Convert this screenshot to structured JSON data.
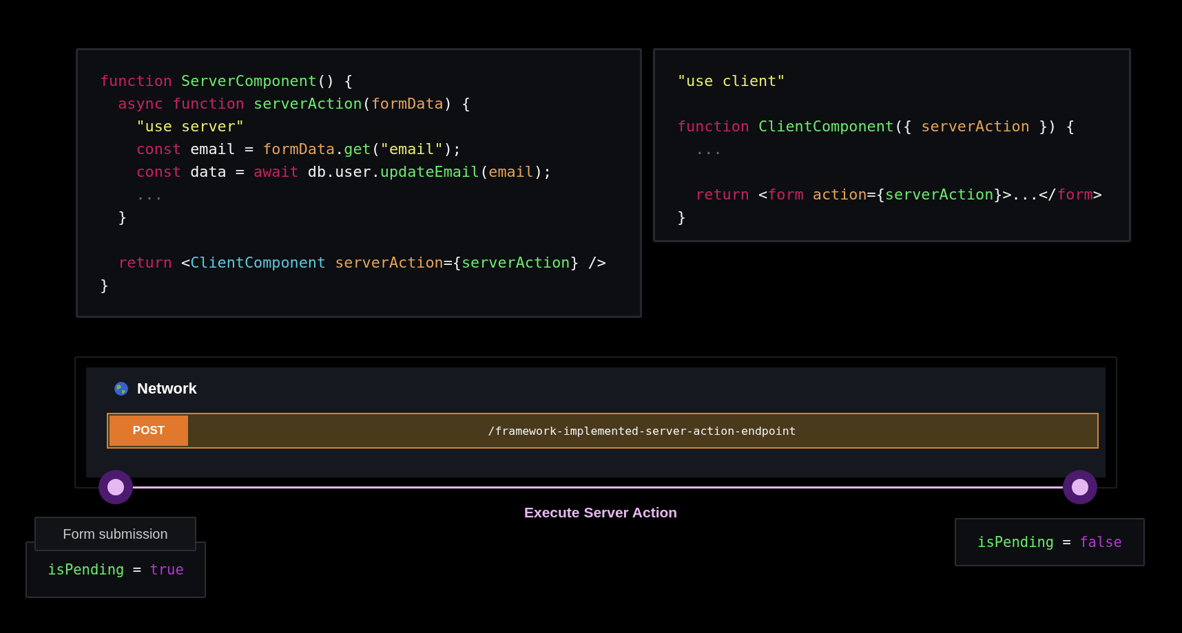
{
  "server_code": {
    "lines": [
      {
        "tokens": [
          {
            "kind": "keyword",
            "text": "function "
          },
          {
            "kind": "fn",
            "text": "ServerComponent"
          },
          {
            "kind": "plain",
            "text": "() {"
          }
        ]
      },
      {
        "tokens": [
          {
            "kind": "keyword",
            "text": "  async function "
          },
          {
            "kind": "fn",
            "text": "serverAction"
          },
          {
            "kind": "plain",
            "text": "("
          },
          {
            "kind": "param",
            "text": "formData"
          },
          {
            "kind": "plain",
            "text": ") {"
          }
        ]
      },
      {
        "tokens": [
          {
            "kind": "string",
            "text": "    \"use server\""
          }
        ]
      },
      {
        "tokens": [
          {
            "kind": "keyword",
            "text": "    const"
          },
          {
            "kind": "plain",
            "text": " email = "
          },
          {
            "kind": "param",
            "text": "formData"
          },
          {
            "kind": "plain",
            "text": "."
          },
          {
            "kind": "fn",
            "text": "get"
          },
          {
            "kind": "plain",
            "text": "("
          },
          {
            "kind": "string",
            "text": "\"email\""
          },
          {
            "kind": "plain",
            "text": ");"
          }
        ]
      },
      {
        "tokens": [
          {
            "kind": "keyword",
            "text": "    const"
          },
          {
            "kind": "plain",
            "text": " data = "
          },
          {
            "kind": "keyword",
            "text": "await"
          },
          {
            "kind": "plain",
            "text": " db.user."
          },
          {
            "kind": "fn",
            "text": "updateEmail"
          },
          {
            "kind": "plain",
            "text": "("
          },
          {
            "kind": "param",
            "text": "email"
          },
          {
            "kind": "plain",
            "text": ");"
          }
        ]
      },
      {
        "tokens": [
          {
            "kind": "comment",
            "text": "    ..."
          }
        ]
      },
      {
        "tokens": [
          {
            "kind": "plain",
            "text": "  }"
          }
        ]
      },
      {
        "blank_before": true,
        "tokens": [
          {
            "kind": "keyword",
            "text": "  return"
          },
          {
            "kind": "plain",
            "text": " <"
          },
          {
            "kind": "component",
            "text": "ClientComponent "
          },
          {
            "kind": "param",
            "text": "serverAction"
          },
          {
            "kind": "plain",
            "text": "={"
          },
          {
            "kind": "fn",
            "text": "serverAction"
          },
          {
            "kind": "plain",
            "text": "} />"
          }
        ]
      },
      {
        "tokens": [
          {
            "kind": "plain",
            "text": "}"
          }
        ]
      }
    ]
  },
  "client_code": {
    "lines": [
      {
        "tokens": [
          {
            "kind": "string",
            "text": "\"use client\""
          }
        ]
      },
      {
        "blank_before": true,
        "tokens": [
          {
            "kind": "keyword",
            "text": "function "
          },
          {
            "kind": "fn",
            "text": "ClientComponent"
          },
          {
            "kind": "plain",
            "text": "({ "
          },
          {
            "kind": "param",
            "text": "serverAction"
          },
          {
            "kind": "plain",
            "text": " }) {"
          }
        ]
      },
      {
        "tokens": [
          {
            "kind": "comment",
            "text": "  ..."
          }
        ]
      },
      {
        "blank_before": true,
        "tokens": [
          {
            "kind": "keyword",
            "text": "  return"
          },
          {
            "kind": "plain",
            "text": " <"
          },
          {
            "kind": "keyword",
            "text": "form "
          },
          {
            "kind": "param",
            "text": "action"
          },
          {
            "kind": "plain",
            "text": "={"
          },
          {
            "kind": "fn",
            "text": "serverAction"
          },
          {
            "kind": "plain",
            "text": "}>...</"
          },
          {
            "kind": "keyword",
            "text": "form"
          },
          {
            "kind": "plain",
            "text": ">"
          }
        ]
      },
      {
        "tokens": [
          {
            "kind": "plain",
            "text": "}"
          }
        ]
      }
    ]
  },
  "network": {
    "title": "Network",
    "request": {
      "method": "POST",
      "url": "/framework-implemented-server-action-endpoint"
    }
  },
  "timeline": {
    "label": "Execute Server Action"
  },
  "start": {
    "label": "Form submission",
    "state": {
      "name": "isPending",
      "op": "=",
      "value": "true"
    }
  },
  "end": {
    "state": {
      "name": "isPending",
      "op": "=",
      "value": "false"
    }
  }
}
